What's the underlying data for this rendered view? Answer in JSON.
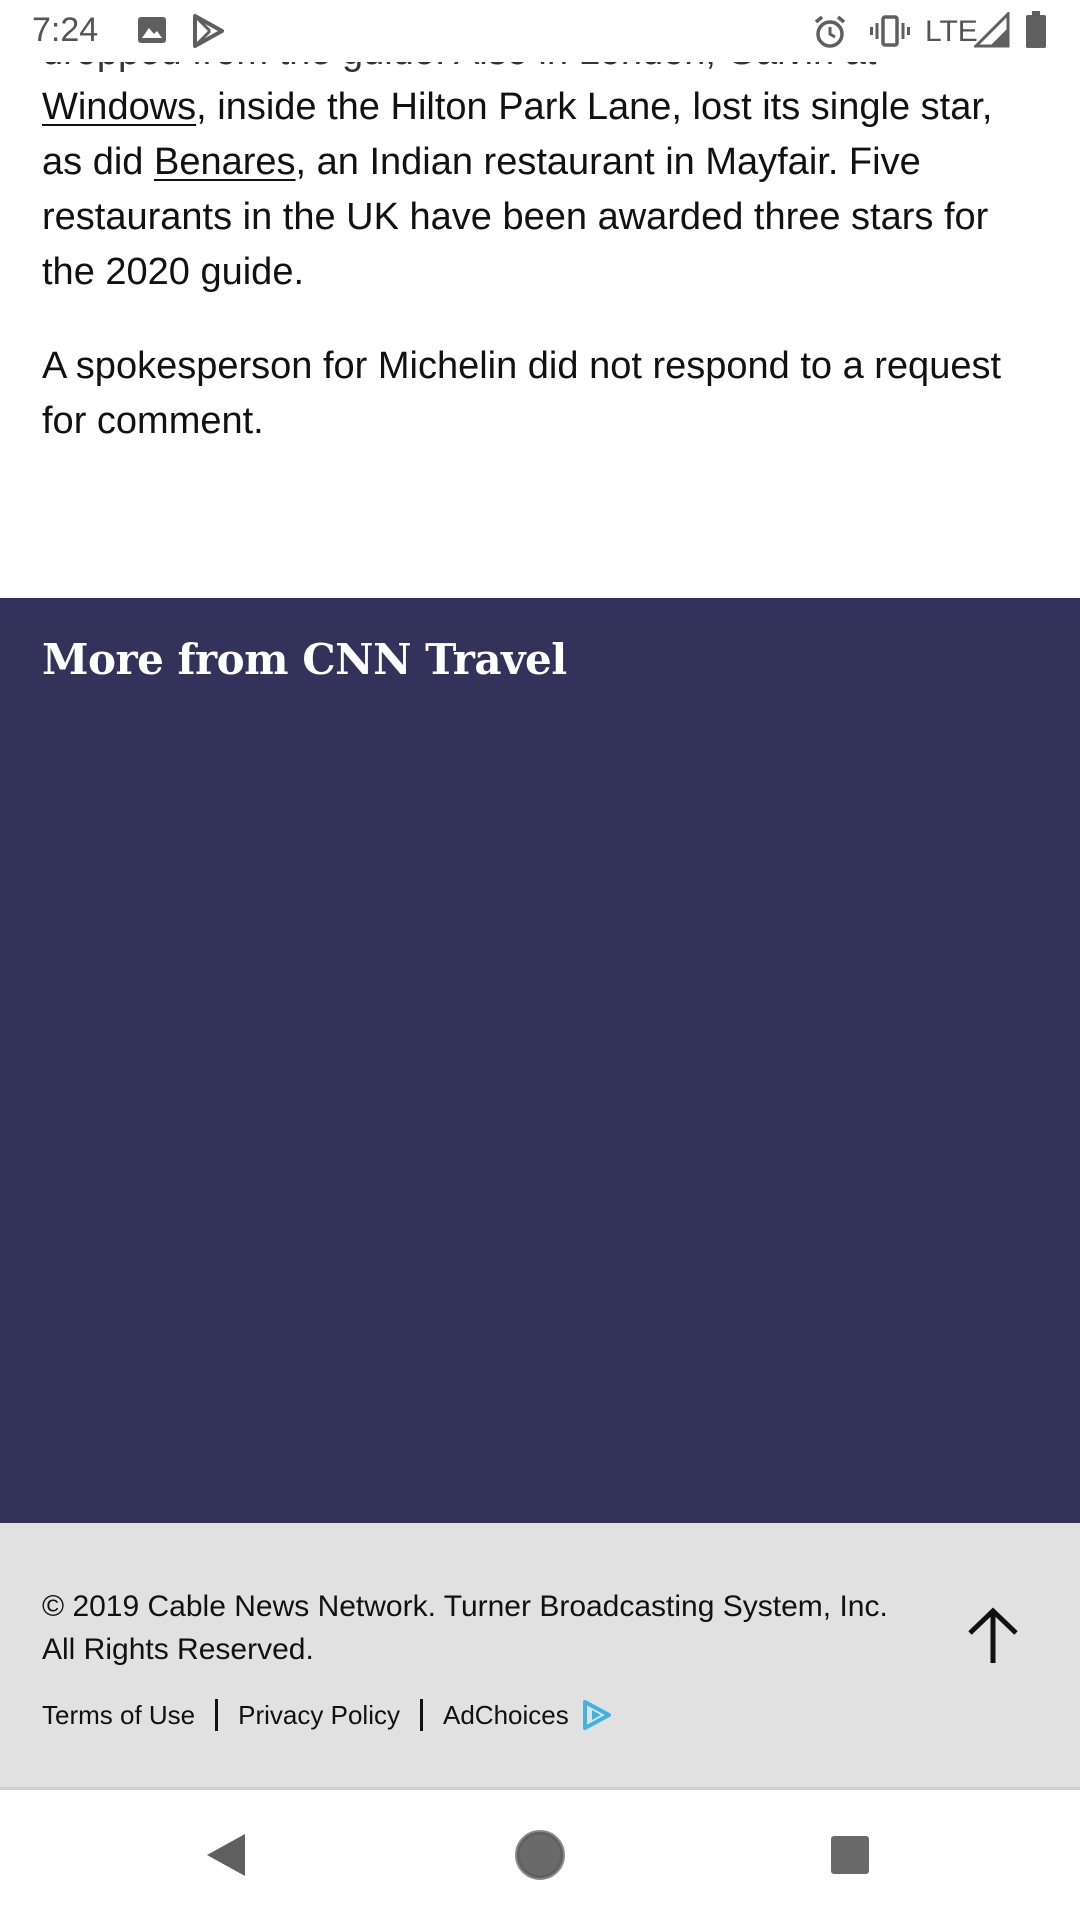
{
  "status_bar": {
    "time": "7:24",
    "network": "LTE",
    "icons": [
      "image-icon",
      "play-store-icon",
      "alarm-icon",
      "vibrate-icon",
      "signal-icon",
      "battery-icon"
    ]
  },
  "article": {
    "para1_cut": "dropped from the guide. Also in London, Galvin at",
    "link_windows": "Windows",
    "para1_text_a": ", inside the Hilton Park Lane, lost its single star, as did ",
    "link_benares": "Benares",
    "para1_text_b": ", an Indian restaurant in Mayfair. Five restaurants in the UK have been awarded three stars for the 2020 guide.",
    "para2": "A spokesperson for Michelin did not respond to a request for comment."
  },
  "more": {
    "title": "More from CNN Travel",
    "background": "#33325a"
  },
  "footer": {
    "copyright": "© 2019 Cable News Network. Turner Broadcasting System, Inc. All Rights Reserved.",
    "links": {
      "terms": "Terms of Use",
      "privacy": "Privacy Policy",
      "adchoices": "AdChoices"
    },
    "back_to_top_icon": "arrow-up-icon",
    "background": "#e1e1e1"
  },
  "nav": {
    "icons": [
      "back-triangle-icon",
      "home-circle-icon",
      "recents-square-icon"
    ]
  }
}
